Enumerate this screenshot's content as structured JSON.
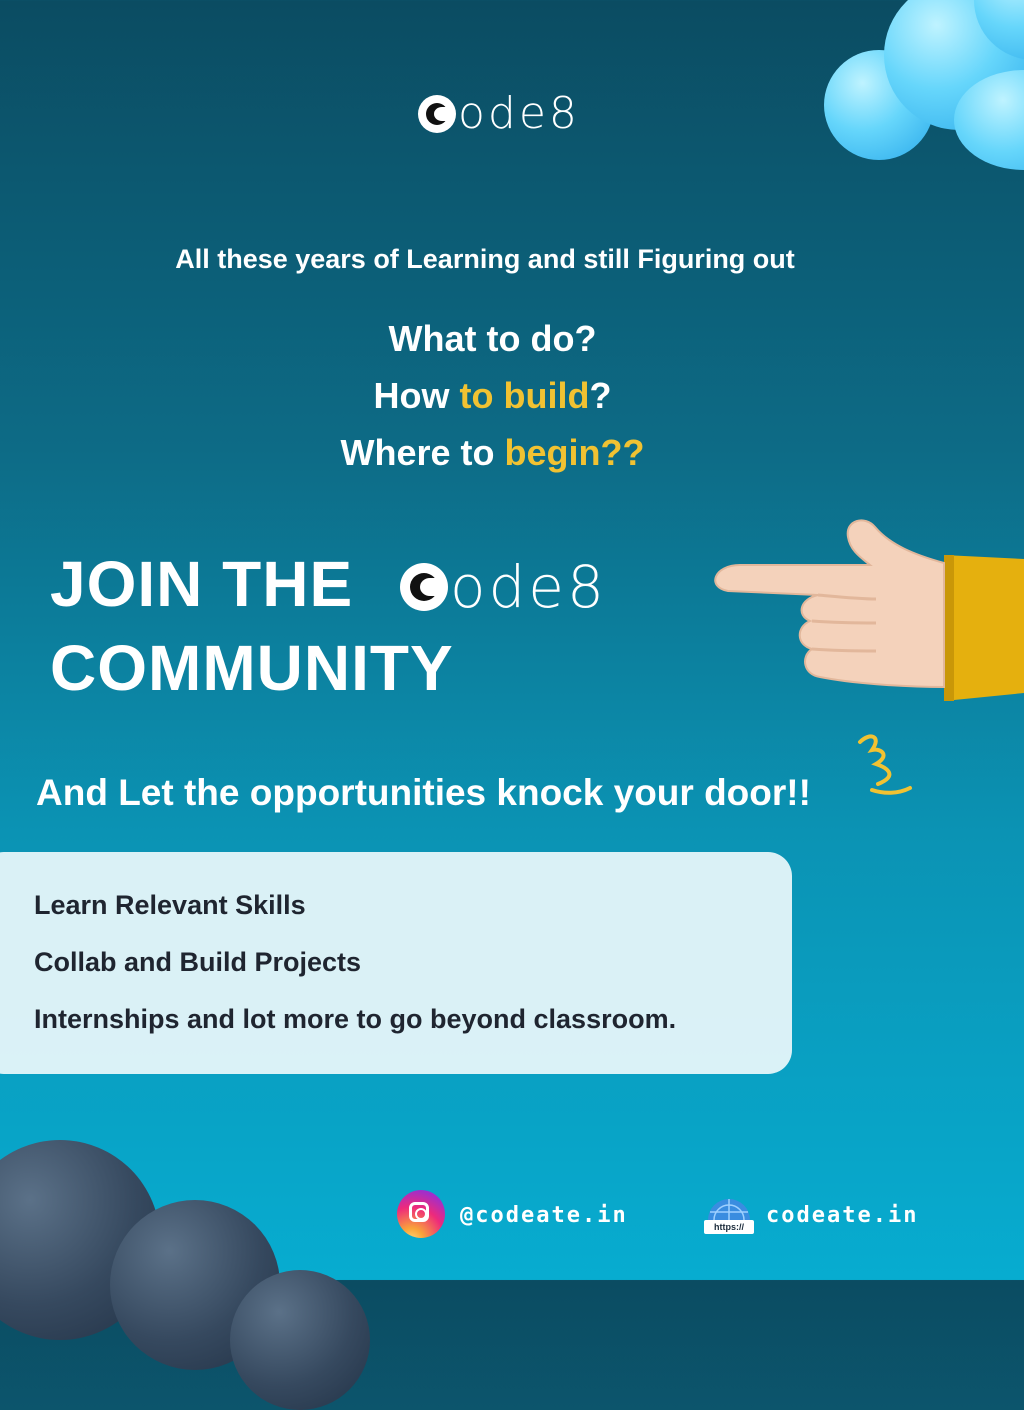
{
  "brand": {
    "logo_text": "ode8"
  },
  "tagline": "All these years of Learning and still Figuring out",
  "questions": [
    {
      "plain": "What to do?",
      "highlight": "",
      "suffix": ""
    },
    {
      "plain": "How ",
      "highlight": "to build",
      "suffix": "?"
    },
    {
      "plain": "Where to ",
      "highlight": "begin??",
      "suffix": ""
    }
  ],
  "join": {
    "line1": "JOIN THE",
    "line2": "COMMUNITY"
  },
  "opportunity_text": "And Let  the opportunities knock your door!!",
  "benefits": [
    "Learn Relevant Skills",
    "Collab and Build Projects",
    "Internships and lot more to go beyond classroom."
  ],
  "footer": {
    "instagram_handle": "@codeate.in",
    "website": "codeate.in",
    "web_icon_label": "https://"
  },
  "colors": {
    "highlight": "#f1c232",
    "bg_top": "#0b4c62",
    "bg_bottom": "#07acd0",
    "card_bg": "#e8f6fa",
    "sleeve": "#e5b00e"
  },
  "icons": [
    "code8-logo-icon",
    "pointing-hand-icon",
    "instagram-icon",
    "globe-icon"
  ]
}
